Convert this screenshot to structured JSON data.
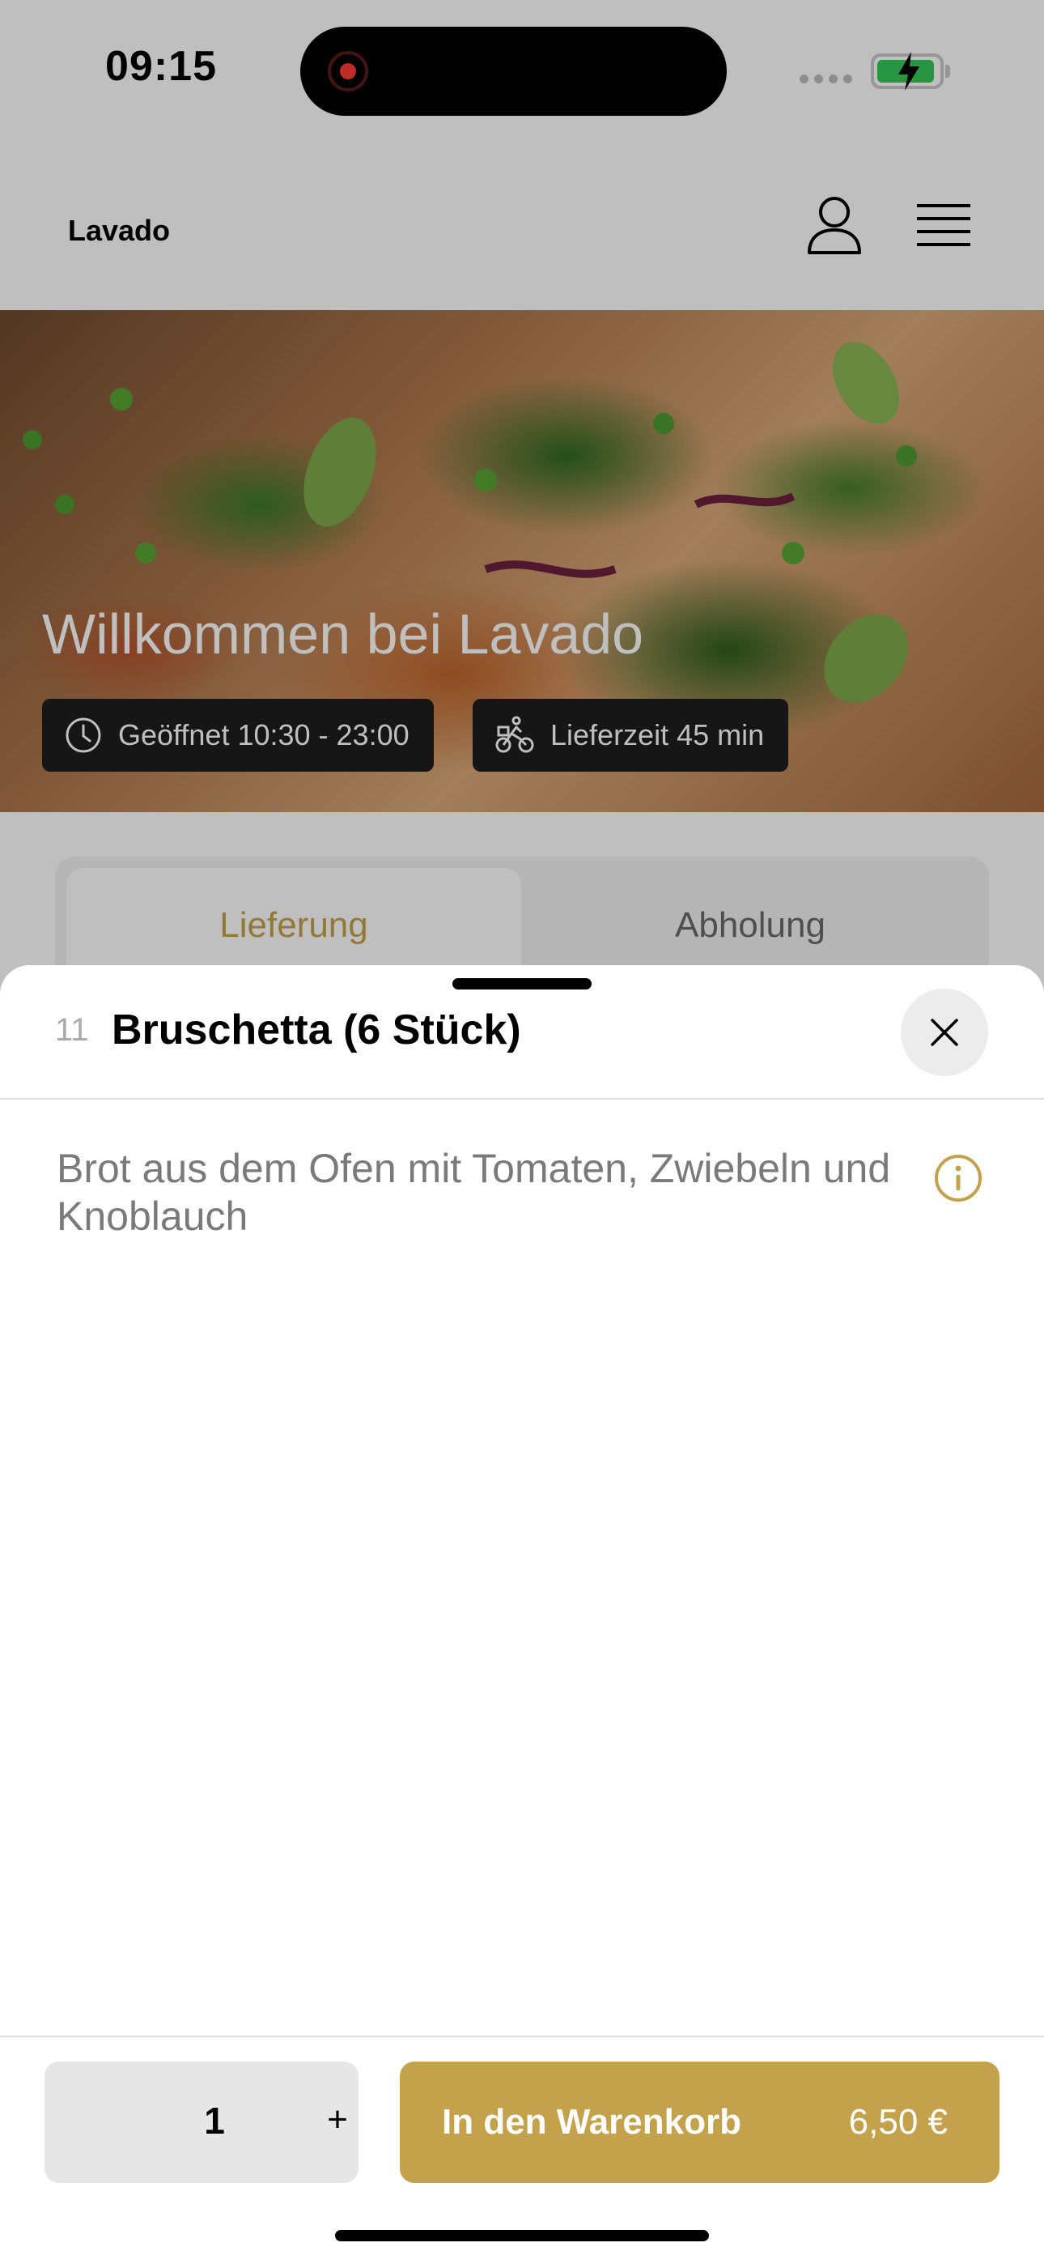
{
  "status_bar": {
    "time": "09:15"
  },
  "header": {
    "brand": "Lavado"
  },
  "hero": {
    "title": "Willkommen bei Lavado",
    "opening_hours": "Geöffnet 10:30 - 23:00",
    "delivery_time": "Lieferzeit 45 min"
  },
  "tabs": [
    {
      "label": "Lieferung",
      "active": true
    },
    {
      "label": "Abholung",
      "active": false
    }
  ],
  "item": {
    "number": "11",
    "title": "Bruschetta (6 Stück)",
    "description": "Brot aus dem Ofen mit Tomaten, Zwiebeln und Knoblauch"
  },
  "footer": {
    "quantity": "1",
    "plus_label": "+",
    "add_to_cart_label": "In den Warenkorb",
    "price": "6,50 €"
  },
  "colors": {
    "accent": "#c4a24c",
    "chip_bg": "#1e1e1e",
    "stepper_bg": "#e6e6e6"
  },
  "icons": [
    "user-icon",
    "menu-icon",
    "clock-icon",
    "bicycle-courier-icon",
    "close-icon",
    "info-icon",
    "record-icon",
    "battery-charging-icon"
  ]
}
